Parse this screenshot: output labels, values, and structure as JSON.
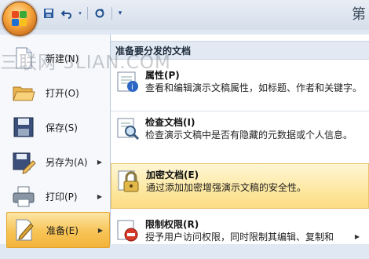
{
  "window": {
    "title_fragment": "第"
  },
  "watermark": "三联网 3LIAN.COM",
  "quick_access": {
    "icons": [
      "save-icon",
      "undo-icon",
      "redo-icon",
      "customize-icon"
    ]
  },
  "left_menu": {
    "items": [
      {
        "label": "新建(N)",
        "icon": "new-document-icon",
        "has_submenu": false
      },
      {
        "label": "打开(O)",
        "icon": "open-folder-icon",
        "has_submenu": false
      },
      {
        "label": "保存(S)",
        "icon": "save-icon",
        "has_submenu": false
      },
      {
        "label": "另存为(A)",
        "icon": "save-as-icon",
        "has_submenu": true
      },
      {
        "label": "打印(P)",
        "icon": "print-icon",
        "has_submenu": true
      },
      {
        "label": "准备(E)",
        "icon": "prepare-icon",
        "has_submenu": true,
        "selected": true
      }
    ]
  },
  "right_pane": {
    "header": "准备要分发的文档",
    "items": [
      {
        "title": "属性(P)",
        "description": "查看和编辑演示文稿属性，如标题、作者和关键字。",
        "icon": "properties-icon"
      },
      {
        "title": "检查文档(I)",
        "description": "检查演示文稿中是否有隐藏的元数据或个人信息。",
        "icon": "inspect-document-icon"
      },
      {
        "title": "加密文档(E)",
        "description": "通过添加加密增强演示文稿的安全性。",
        "icon": "encrypt-document-icon",
        "highlighted": true
      },
      {
        "title": "限制权限(R)",
        "description": "授予用户访问权限，同时限制其编辑、复制和",
        "icon": "restrict-permission-icon",
        "has_submenu": true
      }
    ]
  },
  "colors": {
    "selected_bg": "#f7c456",
    "highlight_bg": "#fde7a0",
    "header_bg": "#e2e9f3"
  }
}
